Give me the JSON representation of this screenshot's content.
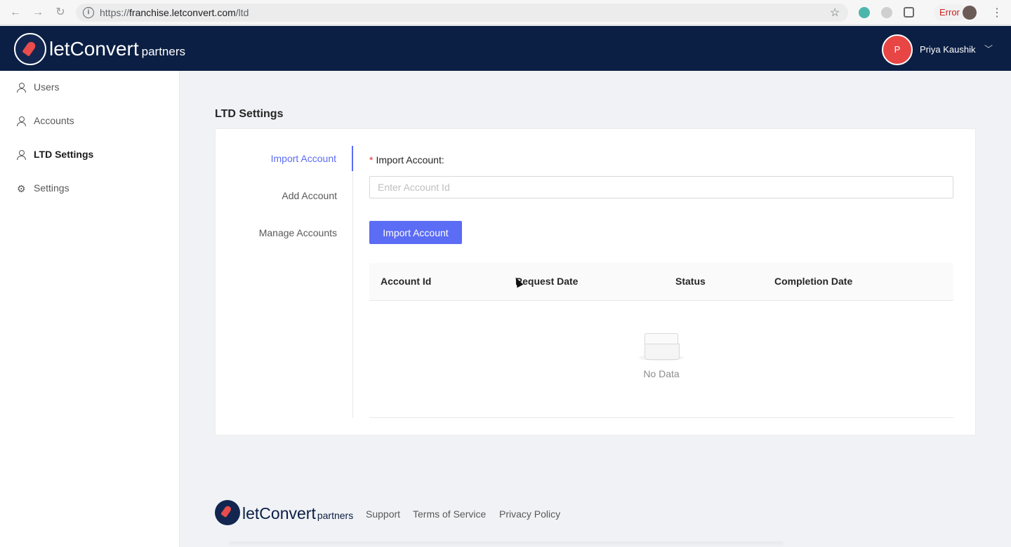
{
  "browser": {
    "url_prefix": "https://",
    "url_domain": "franchise.letconvert.com",
    "url_path": "/ltd",
    "back_glyph": "←",
    "forward_glyph": "→",
    "reload_glyph": "↻",
    "info_glyph": "i",
    "bookmark_glyph": "☆",
    "menu_glyph": "⋮",
    "error_label": "Error"
  },
  "header": {
    "logo_let": "let",
    "logo_convert": "Convert",
    "logo_partners": "partners",
    "user_initial": "P",
    "user_name": "Priya Kaushik",
    "chevron_glyph": "﹀"
  },
  "sidebar": {
    "items": [
      {
        "label": "Users"
      },
      {
        "label": "Accounts"
      },
      {
        "label": "LTD Settings"
      },
      {
        "label": "Settings"
      }
    ],
    "gear_glyph": "⚙"
  },
  "main": {
    "page_title": "LTD Settings",
    "tabs": [
      {
        "label": "Import Account"
      },
      {
        "label": "Add Account"
      },
      {
        "label": "Manage Accounts"
      }
    ],
    "form": {
      "required_mark": "*",
      "label": "Import Account",
      "colon": ":",
      "placeholder": "Enter Account Id",
      "value": "",
      "button_label": "Import Account"
    },
    "table": {
      "columns": [
        "Account Id",
        "Request Date",
        "Status",
        "Completion Date"
      ],
      "empty_text": "No Data"
    }
  },
  "footer": {
    "logo_let": "let",
    "logo_convert": "Convert",
    "logo_partners": "partners",
    "links": [
      "Support",
      "Terms of Service",
      "Privacy Policy"
    ]
  },
  "colors": {
    "header_bg": "#0b1f44",
    "accent": "#5b6cf5",
    "avatar_bg": "#e84545",
    "error_text": "#c5221f"
  }
}
